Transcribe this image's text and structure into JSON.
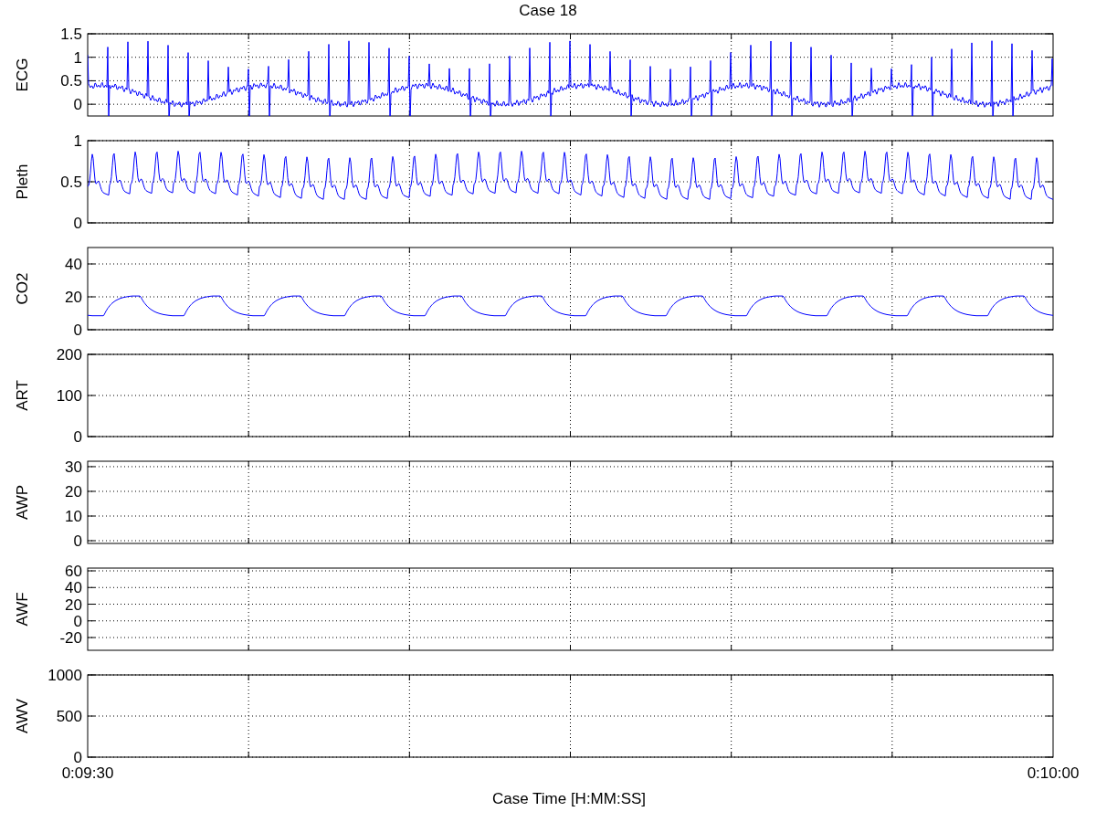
{
  "title": "Case 18",
  "panels": [
    {
      "ylabel": "ECG",
      "kind": "ecg",
      "yticks": [
        "1.5",
        "1",
        "0.5",
        "0"
      ]
    },
    {
      "ylabel": "Pleth",
      "kind": "pleth",
      "yticks": [
        "1",
        "0.5",
        "0"
      ]
    },
    {
      "ylabel": "CO2",
      "kind": "co2",
      "yticks": [
        "40",
        "20",
        "0"
      ]
    },
    {
      "ylabel": "ART",
      "kind": "empty",
      "yticks": [
        "200",
        "100",
        "0"
      ]
    },
    {
      "ylabel": "AWP",
      "kind": "empty",
      "yticks": [
        "30",
        "20",
        "10",
        "0"
      ]
    },
    {
      "ylabel": "AWF",
      "kind": "empty",
      "yticks": [
        "60",
        "40",
        "20",
        "0",
        "-20"
      ]
    },
    {
      "ylabel": "AWV",
      "kind": "empty",
      "yticks": [
        "1000",
        "500",
        "0"
      ]
    }
  ],
  "xticks": [
    "0:09:30",
    "0:10:00"
  ],
  "xlabel": "Case Time [H:MM:SS]"
}
